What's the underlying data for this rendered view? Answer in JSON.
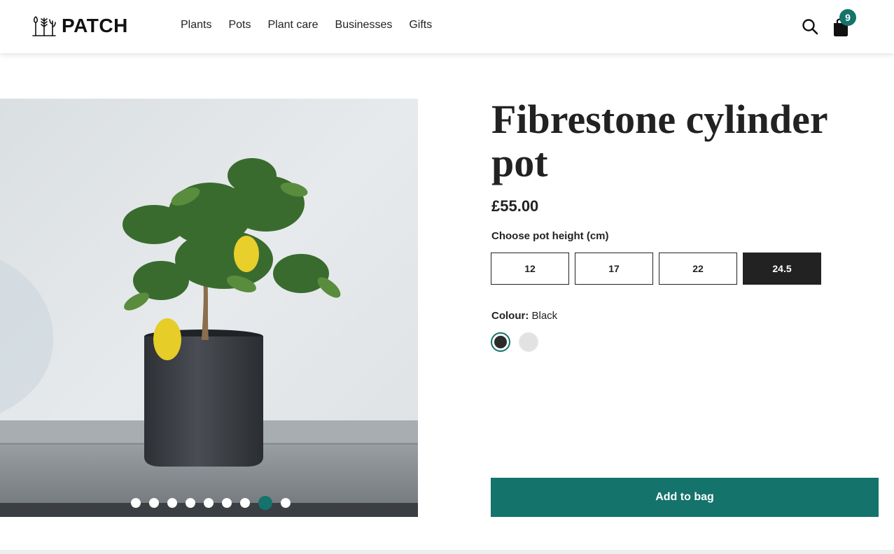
{
  "header": {
    "logo_text": "PATCH",
    "nav": [
      "Plants",
      "Pots",
      "Plant care",
      "Businesses",
      "Gifts"
    ],
    "bag_count": "9",
    "icons": [
      "search-icon",
      "bag-icon"
    ]
  },
  "product": {
    "title": "Fibrestone cylinder pot",
    "price": "£55.00",
    "height_label": "Choose pot height (cm)",
    "heights": [
      "12",
      "17",
      "22",
      "24.5"
    ],
    "selected_height": "24.5",
    "colour_label": "Colour:",
    "colour_value": "Black",
    "swatches": [
      "Black",
      "White"
    ],
    "add_to_bag": "Add to bag"
  },
  "gallery": {
    "slide_count": 9,
    "active_slide": 8
  },
  "colors": {
    "accent": "#14736b",
    "selected": "#222222"
  }
}
